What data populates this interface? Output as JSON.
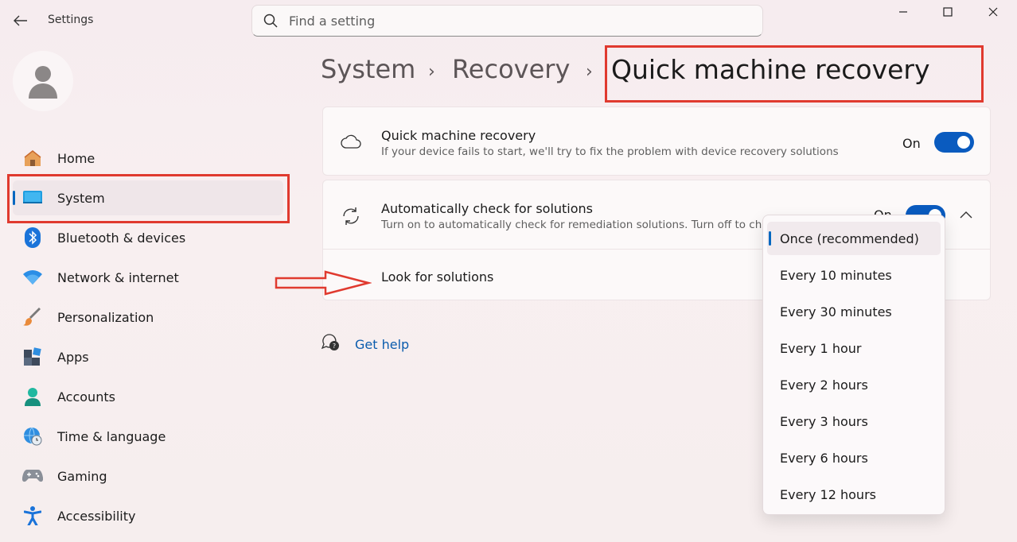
{
  "window": {
    "app_title": "Settings",
    "minimize_icon": "minimize-icon",
    "maximize_icon": "maximize-icon",
    "close_icon": "close-icon"
  },
  "search": {
    "placeholder": "Find a setting",
    "value": ""
  },
  "sidebar": {
    "items": [
      {
        "label": "Home",
        "icon": "home-icon"
      },
      {
        "label": "System",
        "icon": "system-icon",
        "selected": true
      },
      {
        "label": "Bluetooth & devices",
        "icon": "bluetooth-icon"
      },
      {
        "label": "Network & internet",
        "icon": "wifi-icon"
      },
      {
        "label": "Personalization",
        "icon": "brush-icon"
      },
      {
        "label": "Apps",
        "icon": "apps-icon"
      },
      {
        "label": "Accounts",
        "icon": "person-icon"
      },
      {
        "label": "Time & language",
        "icon": "globe-clock-icon"
      },
      {
        "label": "Gaming",
        "icon": "gamepad-icon"
      },
      {
        "label": "Accessibility",
        "icon": "accessibility-icon"
      }
    ]
  },
  "breadcrumb": {
    "items": [
      "System",
      "Recovery"
    ],
    "current": "Quick machine recovery",
    "separator": "›"
  },
  "cards": {
    "qmr": {
      "title": "Quick machine recovery",
      "subtitle": "If your device fails to start, we'll try to fix the problem with device recovery solutions",
      "toggle_label": "On",
      "toggle_on": true
    },
    "auto_check": {
      "title": "Automatically check for solutions",
      "subtitle": "Turn on to automatically check for remediation solutions. Turn off to ch",
      "toggle_label": "On",
      "toggle_on": true
    },
    "look_for": {
      "label": "Look for solutions"
    }
  },
  "dropdown": {
    "selected": "Once (recommended)",
    "options": [
      "Once (recommended)",
      "Every 10 minutes",
      "Every 30 minutes",
      "Every 1 hour",
      "Every 2 hours",
      "Every 3 hours",
      "Every 6 hours",
      "Every 12 hours"
    ]
  },
  "help": {
    "label": "Get help"
  },
  "colors": {
    "accent": "#0a5bbf",
    "annotation": "#e03a2f",
    "link": "#0b5cad"
  }
}
